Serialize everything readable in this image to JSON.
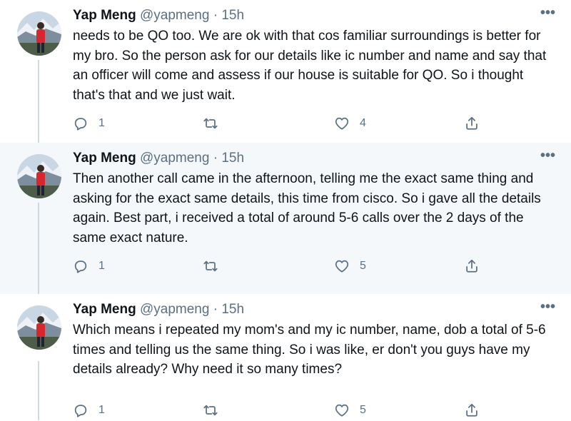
{
  "tweets": [
    {
      "name": "Yap Meng",
      "handle": "@yapmeng",
      "separator": "·",
      "time": "15h",
      "more": "•••",
      "text": "needs to be QO too. We are ok with that cos familiar surroundings is better for my bro. So the person ask for our details like ic number and name and say that an officer will come and assess if our house is suitable for QO. So i thought that's that and we just wait.",
      "reply_count": "1",
      "retweet_count": "",
      "like_count": "4"
    },
    {
      "name": "Yap Meng",
      "handle": "@yapmeng",
      "separator": "·",
      "time": "15h",
      "more": "•••",
      "text": "Then another call came in the afternoon, telling me the exact same thing and asking for the exact same details, this time from cisco. So i gave all the details again. Best part, i received a total of around 5-6 calls over the 2 days of the same exact nature.",
      "reply_count": "1",
      "retweet_count": "",
      "like_count": "5"
    },
    {
      "name": "Yap Meng",
      "handle": "@yapmeng",
      "separator": "·",
      "time": "15h",
      "more": "•••",
      "text": "Which means i repeated my mom's and my ic number, name, dob a total of 5-6 times and telling us the same thing. So i was like, er don't you guys have my details already? Why need it so many times?",
      "reply_count": "1",
      "retweet_count": "",
      "like_count": "5"
    }
  ],
  "icons": {
    "reply": "reply-icon",
    "retweet": "retweet-icon",
    "like": "heart-icon",
    "share": "share-icon",
    "more": "more-icon"
  },
  "colors": {
    "text": "#0f1419",
    "muted": "#5b7083",
    "hover_bg": "#f5f8fa",
    "thread_line": "#cfd9de"
  }
}
